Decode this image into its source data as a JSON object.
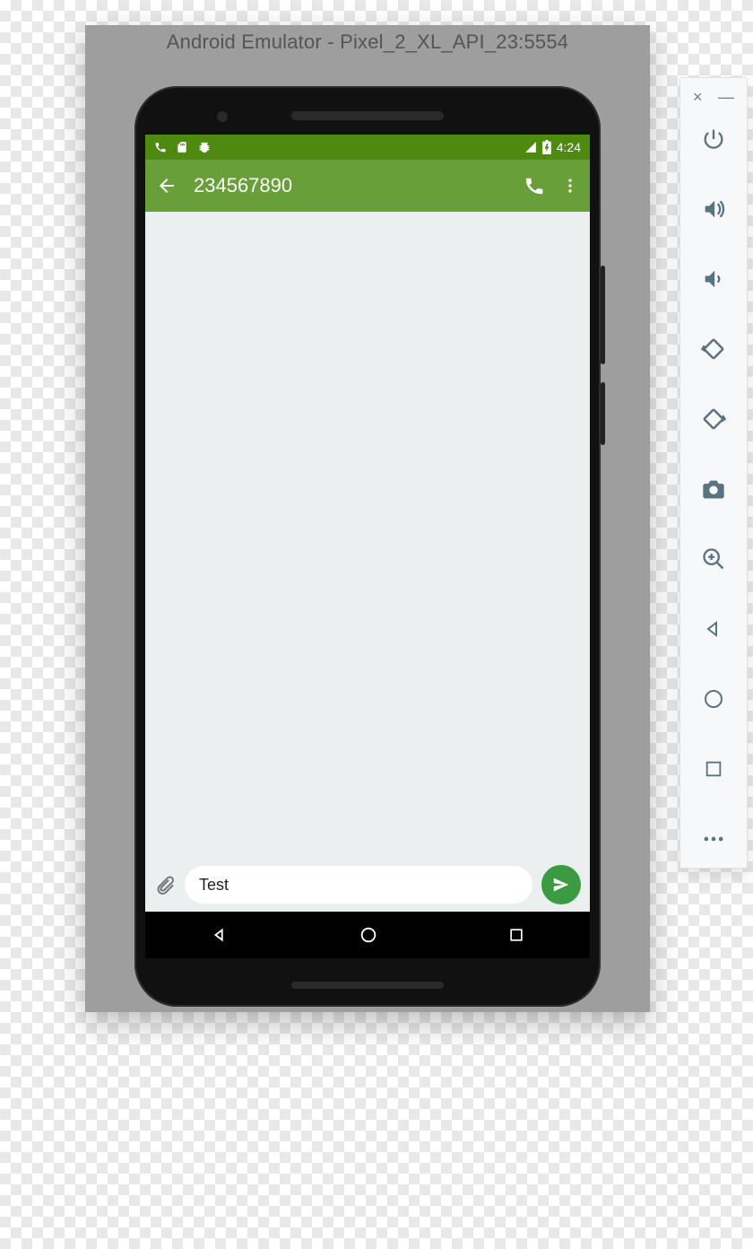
{
  "emulator": {
    "title": "Android Emulator - Pixel_2_XL_API_23:5554"
  },
  "status_bar": {
    "time": "4:24",
    "icons": {
      "phone": "phone-icon",
      "sd": "sd-card-icon",
      "debug": "debug-icon",
      "signal": "signal-icon",
      "battery": "battery-icon"
    }
  },
  "app_bar": {
    "title": "234567890",
    "actions": {
      "call": "call",
      "overflow": "more"
    }
  },
  "compose": {
    "attach_icon": "attach-icon",
    "input_value": "Test",
    "send_icon": "send-icon"
  },
  "nav": {
    "back": "back",
    "home": "home",
    "recents": "recents"
  },
  "side_panel": {
    "close": "×",
    "minimize": "—",
    "buttons": [
      {
        "name": "power-icon",
        "label": "Power"
      },
      {
        "name": "volume-up-icon",
        "label": "Volume up"
      },
      {
        "name": "volume-down-icon",
        "label": "Volume down"
      },
      {
        "name": "rotate-left-icon",
        "label": "Rotate left"
      },
      {
        "name": "rotate-right-icon",
        "label": "Rotate right"
      },
      {
        "name": "camera-icon",
        "label": "Take screenshot"
      },
      {
        "name": "zoom-in-icon",
        "label": "Zoom"
      },
      {
        "name": "back-nav-icon",
        "label": "Back"
      },
      {
        "name": "home-nav-icon",
        "label": "Home"
      },
      {
        "name": "overview-nav-icon",
        "label": "Overview"
      },
      {
        "name": "more-horiz-icon",
        "label": "More"
      }
    ]
  }
}
